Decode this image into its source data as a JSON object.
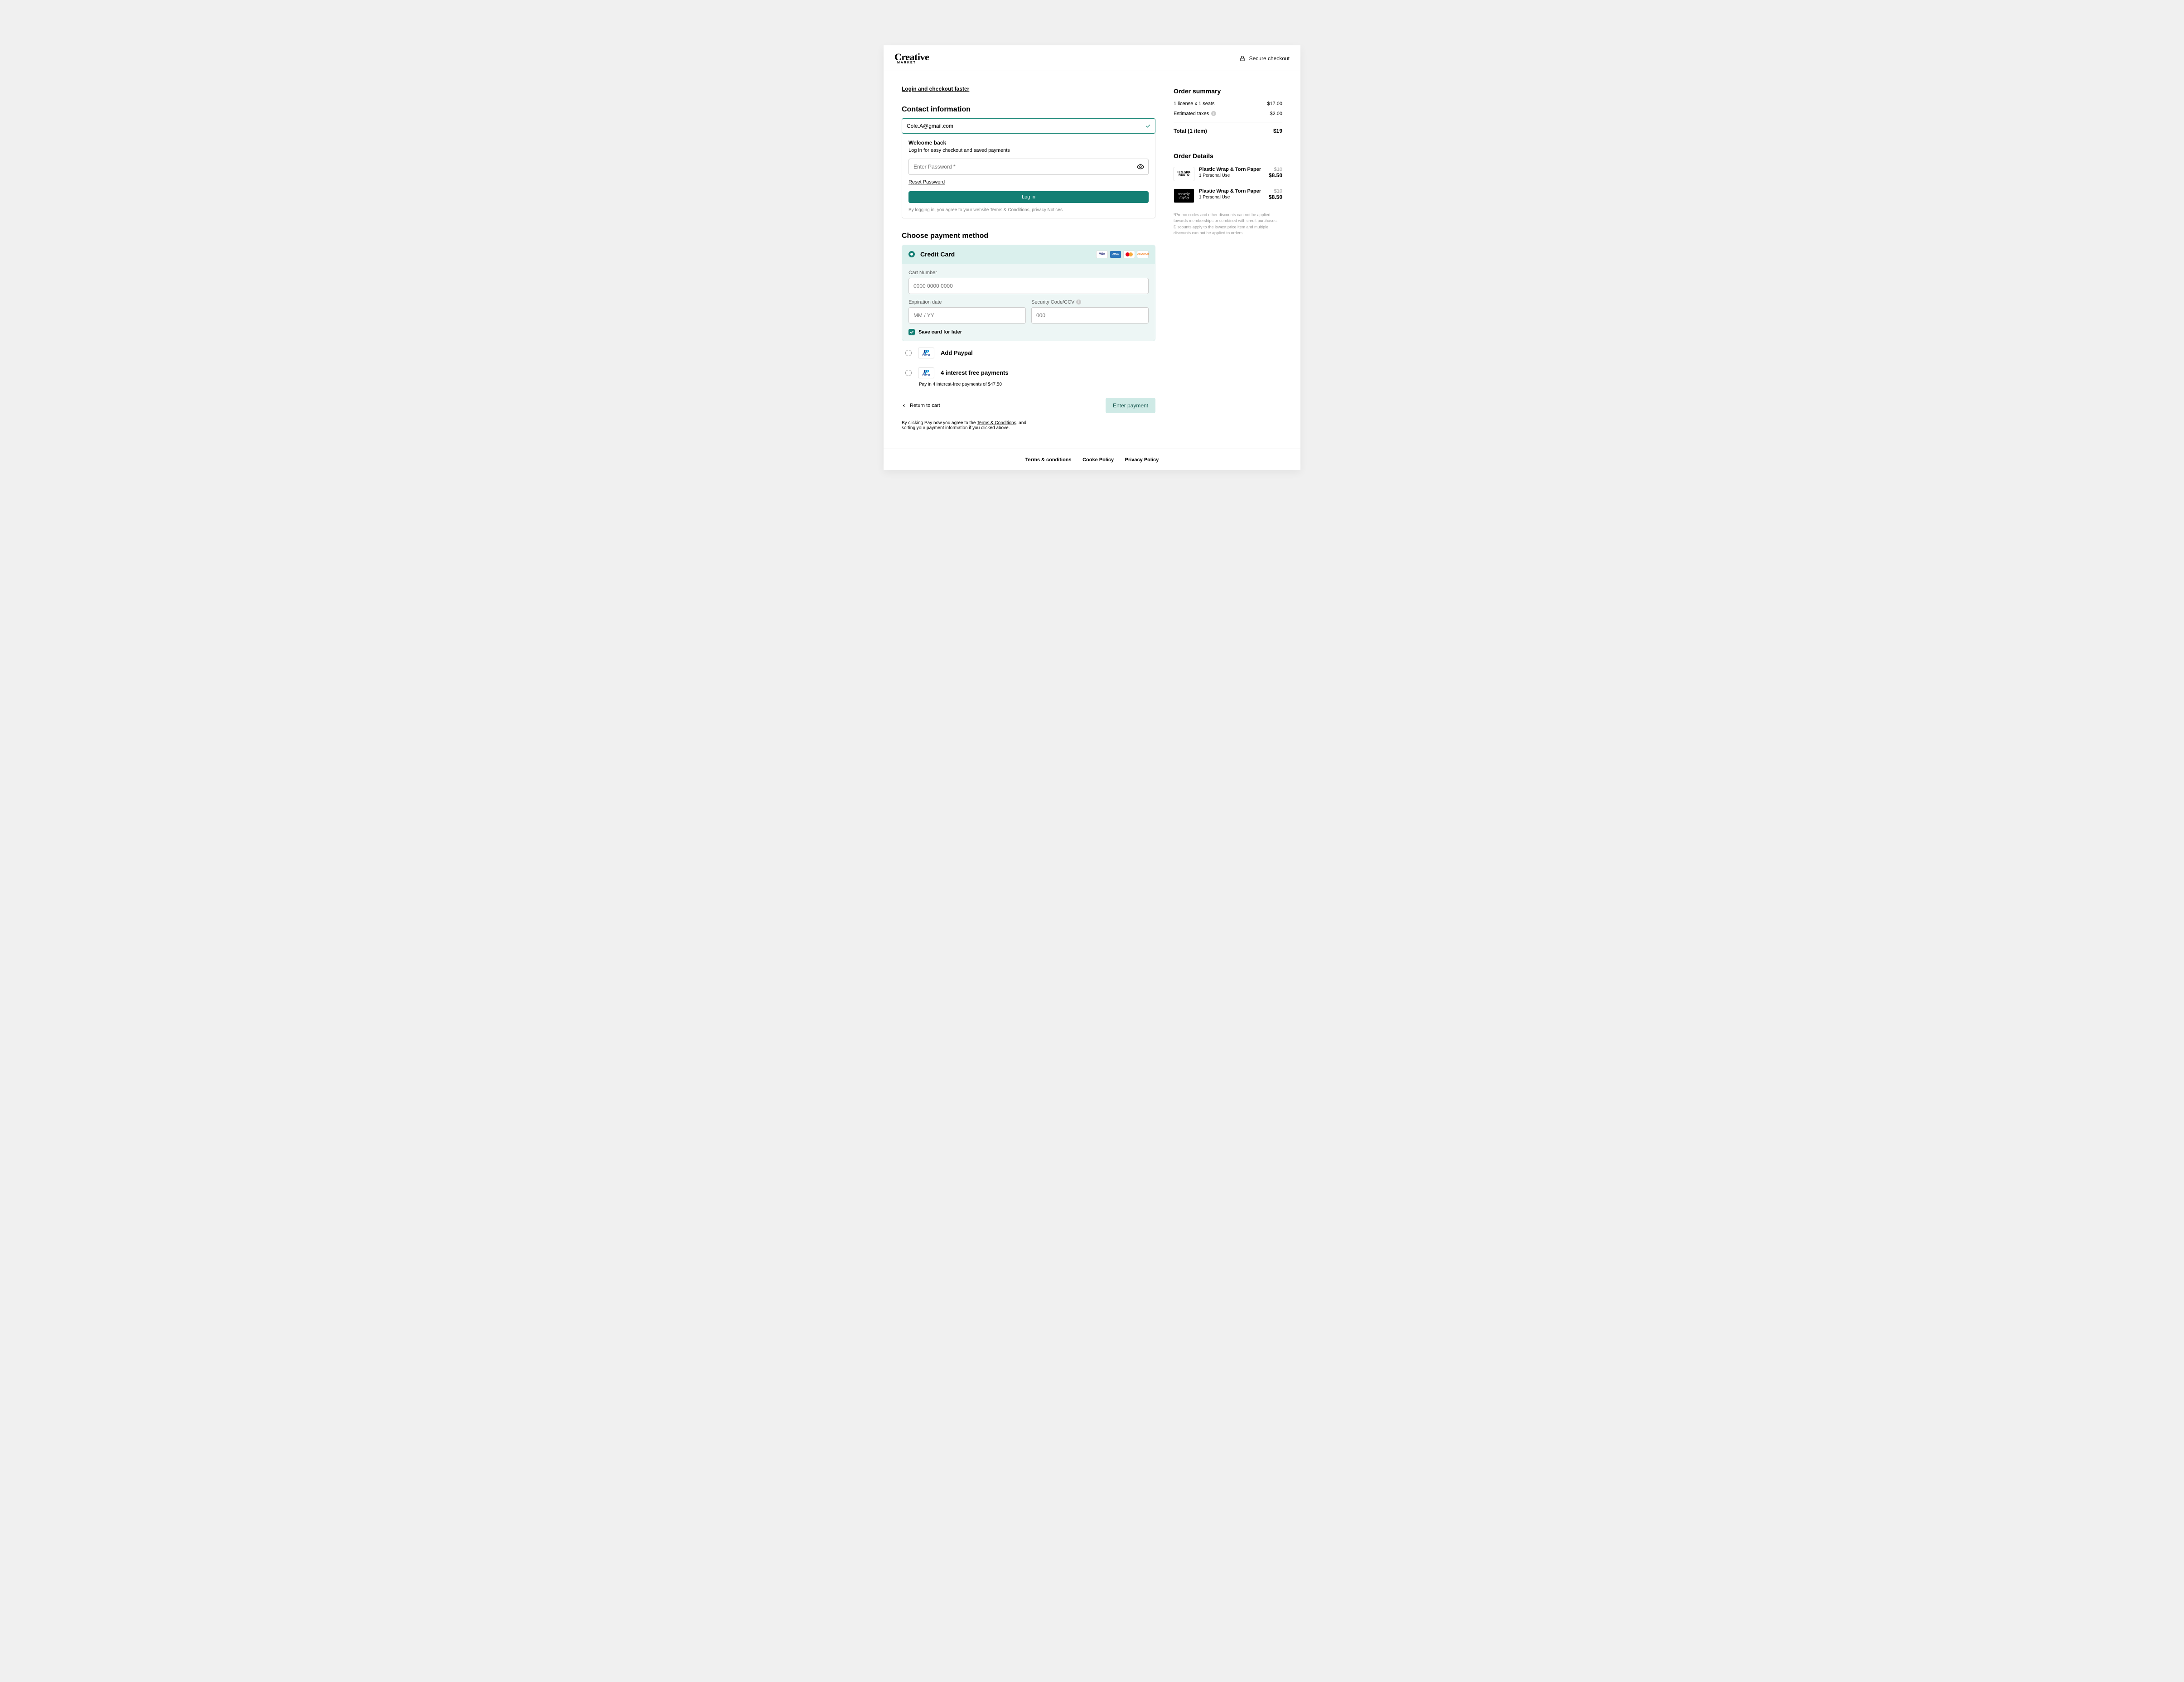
{
  "header": {
    "logo_main": "Creative",
    "logo_sub": "MARKET",
    "secure_text": "Secure checkout"
  },
  "login_link": "Login and checkout faster",
  "contact": {
    "heading": "Contact information",
    "email_value": "Cole.A@gmail.com",
    "welcome_title": "Welcome back",
    "welcome_sub": "Log in for easy checkout and saved payments",
    "password_placeholder": "Enter Password *",
    "reset_pw": "Reset Password",
    "login_btn": "Log in",
    "login_disclaimer": "By logging in, you agree to your website Terms & Conditions, privacy Notices"
  },
  "payment": {
    "heading": "Choose payment method",
    "cc_label": "Credit Card",
    "brand_visa": "VISA",
    "brand_amex": "AMEX",
    "brand_disc": "DISCOVER",
    "card_number_label": "Cart Number",
    "card_number_placeholder": "0000 0000 0000",
    "exp_label": "Expiration date",
    "exp_placeholder": "MM / YY",
    "ccv_label": "Security Code/CCV",
    "ccv_placeholder": "000",
    "save_card_label": "Save card for later",
    "pp_mark_1": "P",
    "pp_mark_2": "P",
    "pp_text": "PayPal",
    "paypal_label": "Add Paypal",
    "pay4_label": "4 interest free payments",
    "pay4_note": "Pay in 4 interest-free payments of $47.50",
    "return_cart": "Return to cart",
    "enter_payment": "Enter payment",
    "agree_pre": "By clicking Pay now you agree to the ",
    "agree_tc": "Terms & Conditions",
    "agree_post": ", and sorting your payment information if you clicked above."
  },
  "summary": {
    "heading": "Order summary",
    "license_label": "1 license x 1 seats",
    "license_price": "$17.00",
    "tax_label": "Estimated taxes",
    "tax_price": "$2.00",
    "total_label": "Total (1 item)",
    "total_price": "$19"
  },
  "details": {
    "heading": "Order Details",
    "items": [
      {
        "thumb_text": "FIRESIDE\nRESTO",
        "name": "Plastic Wrap & Torn Paper",
        "license": "1 Personal Use",
        "orig": "$10",
        "now": "$8.50"
      },
      {
        "thumb_text": "waverly\ndisplay",
        "name": "Plastic Wrap & Torn Paper",
        "license": "1 Personal Use",
        "orig": "$10",
        "now": "$8.50"
      }
    ],
    "promo_note": "*Promo codes and other discounts can not be applied towards memberships or combined with credit purchases. Discounts apply to the lowest price item and multiple discounts can not be applied to orders."
  },
  "footer": {
    "terms": "Terms & conditions",
    "cookie": "Cooke Policy",
    "privacy": "Privacy Policy"
  }
}
